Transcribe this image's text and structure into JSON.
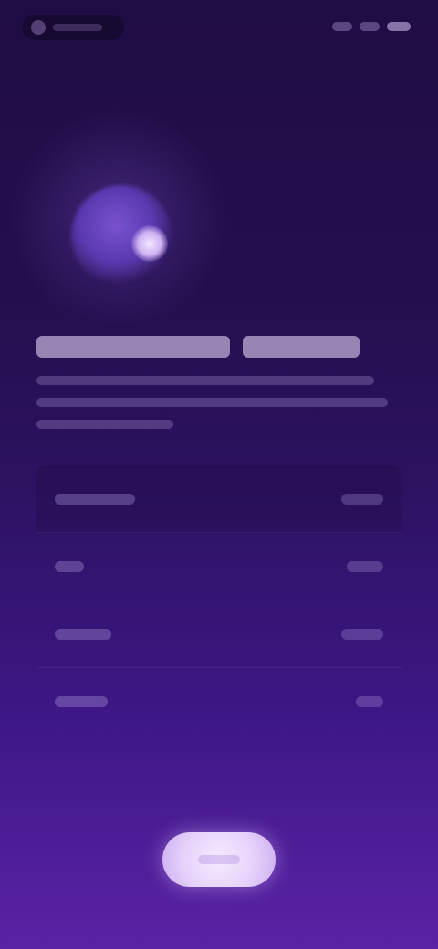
{
  "status_bar": {
    "app_icon": "app-icon"
  },
  "hero": {
    "icon": "moon-planet-icon"
  },
  "colors": {
    "background_top": "#1f0d45",
    "background_bottom": "#5a22a6",
    "accent": "#e6d2fb"
  },
  "list": {
    "rows": [
      {
        "id": "row-1"
      },
      {
        "id": "row-2"
      },
      {
        "id": "row-3"
      },
      {
        "id": "row-4"
      }
    ]
  }
}
